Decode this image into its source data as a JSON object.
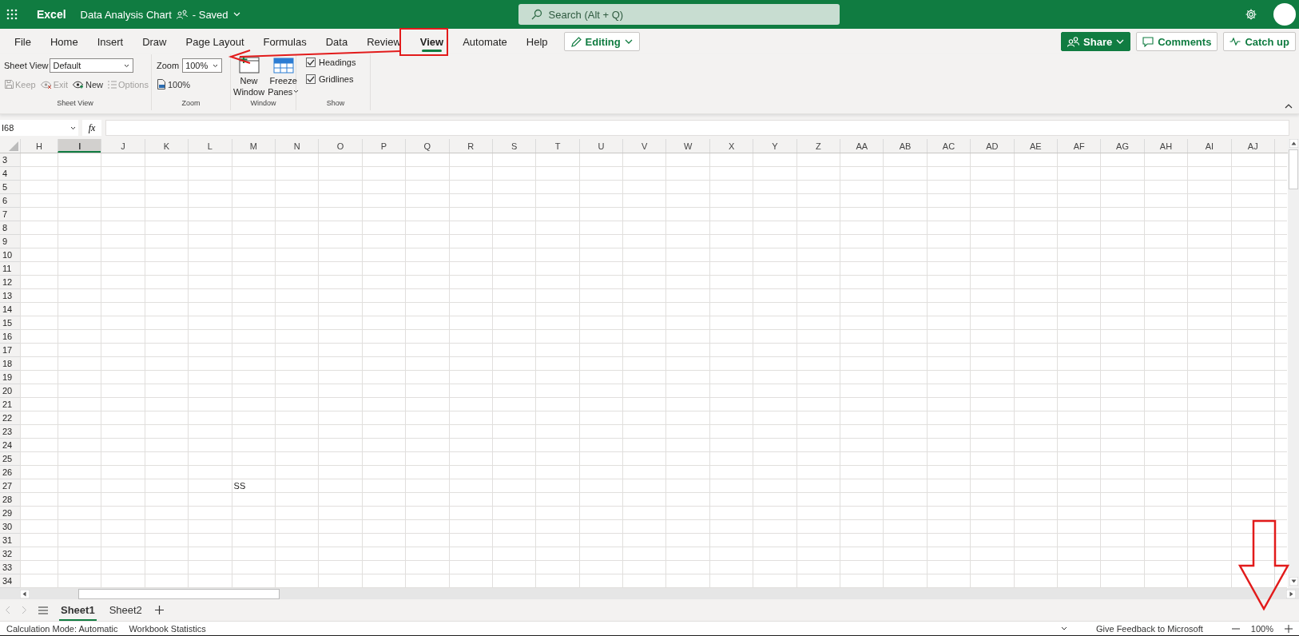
{
  "app_bar": {
    "app_name": "Excel",
    "doc_title": "Data Analysis Chart",
    "save_status": "- Saved",
    "search": {
      "placeholder": "Search (Alt + Q)"
    }
  },
  "ribbon_tabs": [
    {
      "label": "File",
      "selected": false
    },
    {
      "label": "Home",
      "selected": false
    },
    {
      "label": "Insert",
      "selected": false
    },
    {
      "label": "Draw",
      "selected": false
    },
    {
      "label": "Page Layout",
      "selected": false
    },
    {
      "label": "Formulas",
      "selected": false
    },
    {
      "label": "Data",
      "selected": false
    },
    {
      "label": "Review",
      "selected": false
    },
    {
      "label": "View",
      "selected": true
    },
    {
      "label": "Automate",
      "selected": false
    },
    {
      "label": "Help",
      "selected": false
    }
  ],
  "editing_button": "Editing",
  "actions": [
    {
      "kind": "share",
      "label": "Share"
    },
    {
      "kind": "comments",
      "label": "Comments"
    },
    {
      "kind": "catchup",
      "label": "Catch up"
    }
  ],
  "sheet_view": {
    "label": "Sheet View",
    "value": "Default",
    "group": "Sheet View",
    "buttons": [
      {
        "kind": "save",
        "label": "Keep",
        "disabled": true
      },
      {
        "kind": "exit",
        "label": "Exit",
        "disabled": true
      },
      {
        "kind": "new",
        "label": "New",
        "disabled": false
      },
      {
        "kind": "options",
        "label": "Options",
        "disabled": true
      }
    ]
  },
  "zoom": {
    "label": "Zoom",
    "value": "100%",
    "button": "100%",
    "group": "Zoom"
  },
  "window": {
    "group": "Window",
    "buttons": [
      {
        "kind": "new-window",
        "lines": [
          "New",
          "Window"
        ],
        "caret": false
      },
      {
        "kind": "freeze",
        "lines": [
          "Freeze",
          "Panes"
        ],
        "caret": true
      }
    ]
  },
  "show": {
    "group": "Show",
    "options": [
      {
        "label": "Headings",
        "checked": true
      },
      {
        "label": "Gridlines",
        "checked": true
      }
    ]
  },
  "formula_bar": {
    "name_box": "I68",
    "fx": "fx"
  },
  "grid": {
    "columns": [
      {
        "label": "H",
        "selected": false
      },
      {
        "label": "I",
        "selected": true
      },
      {
        "label": "J",
        "selected": false
      },
      {
        "label": "K",
        "selected": false
      },
      {
        "label": "L",
        "selected": false
      },
      {
        "label": "M",
        "selected": false
      },
      {
        "label": "N",
        "selected": false
      },
      {
        "label": "O",
        "selected": false
      },
      {
        "label": "P",
        "selected": false
      },
      {
        "label": "Q",
        "selected": false
      },
      {
        "label": "R",
        "selected": false
      },
      {
        "label": "S",
        "selected": false
      },
      {
        "label": "T",
        "selected": false
      },
      {
        "label": "U",
        "selected": false
      },
      {
        "label": "V",
        "selected": false
      },
      {
        "label": "W",
        "selected": false
      },
      {
        "label": "X",
        "selected": false
      },
      {
        "label": "Y",
        "selected": false
      },
      {
        "label": "Z",
        "selected": false
      },
      {
        "label": "AA",
        "selected": false
      },
      {
        "label": "AB",
        "selected": false
      },
      {
        "label": "AC",
        "selected": false
      },
      {
        "label": "AD",
        "selected": false
      },
      {
        "label": "AE",
        "selected": false
      },
      {
        "label": "AF",
        "selected": false
      },
      {
        "label": "AG",
        "selected": false
      },
      {
        "label": "AH",
        "selected": false
      },
      {
        "label": "AI",
        "selected": false
      },
      {
        "label": "AJ",
        "selected": false
      }
    ],
    "rows": [
      {
        "header": "3"
      },
      {
        "header": "4"
      },
      {
        "header": "5"
      },
      {
        "header": "6"
      },
      {
        "header": "7"
      },
      {
        "header": "8"
      },
      {
        "header": "9"
      },
      {
        "header": "10"
      },
      {
        "header": "11"
      },
      {
        "header": "12"
      },
      {
        "header": "13"
      },
      {
        "header": "14"
      },
      {
        "header": "15"
      },
      {
        "header": "16"
      },
      {
        "header": "17"
      },
      {
        "header": "18"
      },
      {
        "header": "19"
      },
      {
        "header": "20"
      },
      {
        "header": "21"
      },
      {
        "header": "22"
      },
      {
        "header": "23"
      },
      {
        "header": "24"
      },
      {
        "header": "25"
      },
      {
        "header": "26"
      },
      {
        "header": "27",
        "cells": [
          null,
          null,
          null,
          null,
          null,
          "SS"
        ]
      },
      {
        "header": "28"
      },
      {
        "header": "29"
      },
      {
        "header": "30"
      },
      {
        "header": "31"
      },
      {
        "header": "32"
      },
      {
        "header": "33"
      },
      {
        "header": "34"
      }
    ]
  },
  "sheet_tabs": [
    {
      "label": "Sheet1",
      "selected": true
    },
    {
      "label": "Sheet2",
      "selected": false
    }
  ],
  "status_bar": {
    "items": [
      "Calculation Mode: Automatic",
      "Workbook Statistics"
    ],
    "feedback": "Give Feedback to Microsoft",
    "zoom": "100%"
  }
}
